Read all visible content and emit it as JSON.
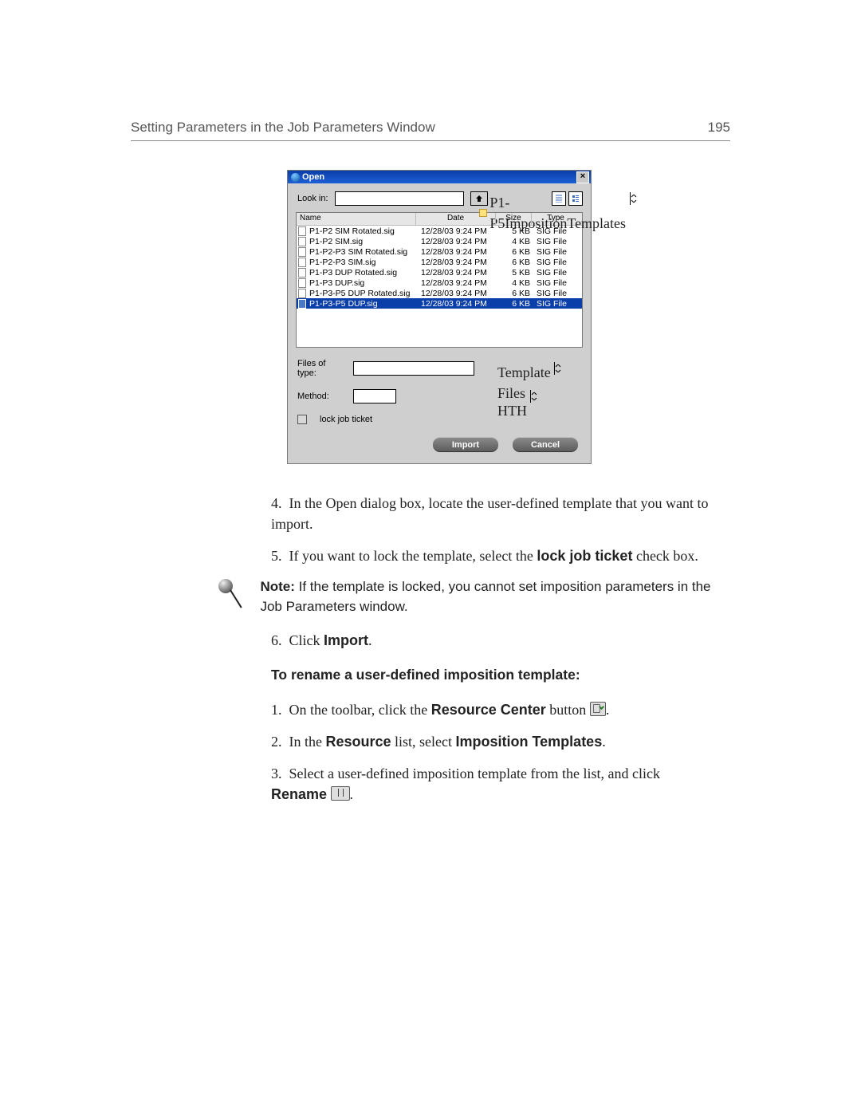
{
  "header": {
    "title": "Setting Parameters in the Job Parameters Window",
    "page": "195"
  },
  "dialog": {
    "title": "Open",
    "lookin_label": "Look in:",
    "lookin_value": "P1-P5ImpositionTemplates",
    "columns": {
      "name": "Name",
      "date": "Date",
      "size": "Size",
      "type": "Type"
    },
    "files": [
      {
        "name": "P1-P2 SIM Rotated.sig",
        "date": "12/28/03 9:24 PM",
        "size": "5 KB",
        "type": "SIG File",
        "sel": false
      },
      {
        "name": "P1-P2 SIM.sig",
        "date": "12/28/03 9:24 PM",
        "size": "4 KB",
        "type": "SIG File",
        "sel": false
      },
      {
        "name": "P1-P2-P3 SIM Rotated.sig",
        "date": "12/28/03 9:24 PM",
        "size": "6 KB",
        "type": "SIG File",
        "sel": false
      },
      {
        "name": "P1-P2-P3 SIM.sig",
        "date": "12/28/03 9:24 PM",
        "size": "6 KB",
        "type": "SIG File",
        "sel": false
      },
      {
        "name": "P1-P3 DUP Rotated.sig",
        "date": "12/28/03 9:24 PM",
        "size": "5 KB",
        "type": "SIG File",
        "sel": false
      },
      {
        "name": "P1-P3 DUP.sig",
        "date": "12/28/03 9:24 PM",
        "size": "4 KB",
        "type": "SIG File",
        "sel": false
      },
      {
        "name": "P1-P3-P5 DUP Rotated.sig",
        "date": "12/28/03 9:24 PM",
        "size": "6 KB",
        "type": "SIG File",
        "sel": false
      },
      {
        "name": "P1-P3-P5 DUP.sig",
        "date": "12/28/03 9:24 PM",
        "size": "6 KB",
        "type": "SIG File",
        "sel": true
      }
    ],
    "filetype_label": "Files of type:",
    "filetype_value": "Template Files",
    "method_label": "Method:",
    "method_value": "HTH",
    "lock_label": "lock job ticket",
    "btn_import": "Import",
    "btn_cancel": "Cancel"
  },
  "steps_a": {
    "s4_num": "4.",
    "s4": "In the Open dialog box, locate the user-defined template that you want to import.",
    "s5_num": "5.",
    "s5_a": "If you want to lock the template, select the ",
    "s5_b": "lock job ticket",
    "s5_c": " check box.",
    "note_lead": "Note:",
    "note": "  If the template is locked, you cannot set imposition parameters in the Job Parameters window.",
    "s6_num": "6.",
    "s6_a": "Click ",
    "s6_b": "Import",
    "s6_c": "."
  },
  "subhead": "To rename a user-defined imposition template:",
  "steps_b": {
    "s1_num": "1.",
    "s1_a": "On the toolbar, click the ",
    "s1_b": "Resource Center",
    "s1_c": " button ",
    "s1_d": ".",
    "s2_num": "2.",
    "s2_a": "In the ",
    "s2_b": "Resource",
    "s2_c": " list, select ",
    "s2_d": "Imposition Templates",
    "s2_e": ".",
    "s3_num": "3.",
    "s3_a": " Select a user-defined imposition template from the list, and click ",
    "s3_b": "Rename",
    "s3_c": " ",
    "s3_d": "."
  }
}
